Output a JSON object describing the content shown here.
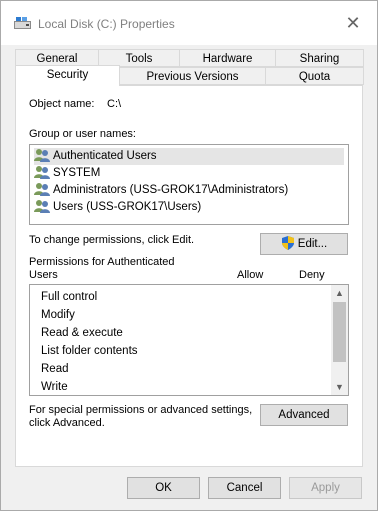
{
  "window": {
    "title": "Local Disk (C:) Properties",
    "close_glyph": "✕"
  },
  "tabs_row1": [
    "General",
    "Tools",
    "Hardware",
    "Sharing"
  ],
  "tabs_row2": [
    "Security",
    "Previous Versions",
    "Quota"
  ],
  "selected_tab": "Security",
  "object": {
    "label": "Object name:",
    "value": "C:\\"
  },
  "groups": {
    "label": "Group or user names:",
    "items": [
      "Authenticated Users",
      "SYSTEM",
      "Administrators (USS-GROK17\\Administrators)",
      "Users (USS-GROK17\\Users)"
    ],
    "selected_index": 0
  },
  "change_text": "To change permissions, click Edit.",
  "edit_button": "Edit...",
  "permissions": {
    "label_line1": "Permissions for Authenticated",
    "label_line2": "Users",
    "col_allow": "Allow",
    "col_deny": "Deny",
    "items": [
      "Full control",
      "Modify",
      "Read & execute",
      "List folder contents",
      "Read",
      "Write"
    ]
  },
  "special": {
    "line1": "For special permissions or advanced settings,",
    "line2": "click Advanced.",
    "button": "Advanced"
  },
  "footer": {
    "ok": "OK",
    "cancel": "Cancel",
    "apply": "Apply"
  },
  "colors": {
    "dialog_bg": "#f0f0f0",
    "panel_bg": "#ffffff",
    "selection": "#e5e5e5",
    "button_bg": "#e1e1e1"
  }
}
